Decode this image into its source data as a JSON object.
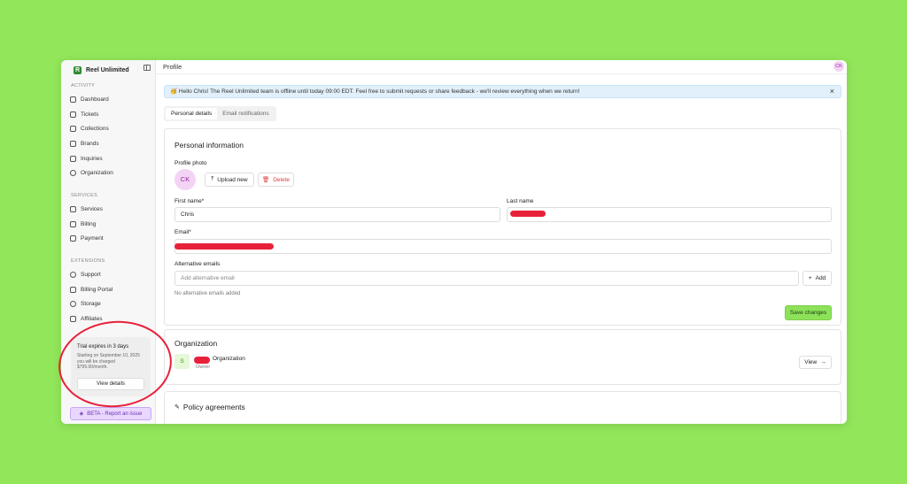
{
  "sidebar": {
    "brand": "Reel Unlimited",
    "sections": [
      {
        "title": "ACTIVITY",
        "items": [
          "Dashboard",
          "Tickets",
          "Collections",
          "Brands",
          "Inquiries",
          "Organization"
        ]
      },
      {
        "title": "SERVICES",
        "items": [
          "Services",
          "Billing",
          "Payment"
        ]
      },
      {
        "title": "EXTENSIONS",
        "items": [
          "Support",
          "Billing Portal",
          "Storage",
          "Affiliates"
        ]
      }
    ],
    "trial": {
      "title": "Trial expires in 3 days",
      "text": "Starting on September 10, 2025 you will be charged $795.00/month.",
      "button": "View details"
    },
    "beta": "BETA - Report an issue"
  },
  "header": {
    "title": "Profile",
    "avatar": "CK"
  },
  "banner": {
    "text": "🥳 Hello Chris! The Reel Unlimited team is offline until today 09:00 EDT. Feel free to submit requests or share feedback - we'll review everything when we return!",
    "close": "×"
  },
  "tabs": [
    "Personal details",
    "Email notifications"
  ],
  "personal": {
    "title": "Personal information",
    "photo_label": "Profile photo",
    "avatar": "CK",
    "upload": "Upload new",
    "delete": "Delete",
    "first_name_label": "First name*",
    "first_name": "Chris",
    "last_name_label": "Last name",
    "email_label": "Email*",
    "alt_emails_label": "Alternative emails",
    "alt_placeholder": "Add alternative email",
    "add": "Add",
    "no_alt": "No alternative emails added",
    "save": "Save changes"
  },
  "organization": {
    "title": "Organization",
    "badge": "S",
    "name": "Organization",
    "role": "Owner",
    "view": "View"
  },
  "policy": {
    "title": "Policy agreements"
  },
  "colors": {
    "accent": "#8de25a",
    "annotation": "#e8213a",
    "beta": "#e9d7ff"
  }
}
